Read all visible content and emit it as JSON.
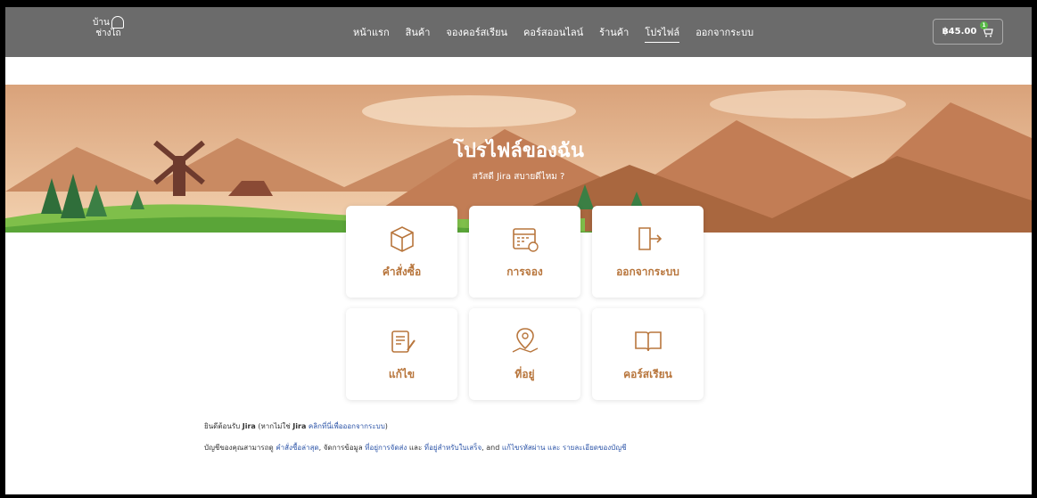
{
  "logo": {
    "line1": "บ้าน",
    "line2": "ช่างไถ"
  },
  "nav": [
    {
      "label": "หน้าแรก",
      "active": false
    },
    {
      "label": "สินค้า",
      "active": false
    },
    {
      "label": "จองคอร์สเรียน",
      "active": false
    },
    {
      "label": "คอร์สออนไลน์",
      "active": false
    },
    {
      "label": "ร้านค้า",
      "active": false
    },
    {
      "label": "โปรไฟล์",
      "active": true
    },
    {
      "label": "ออกจากระบบ",
      "active": false
    }
  ],
  "cart": {
    "amount": "฿45.00",
    "count": "1"
  },
  "hero": {
    "title": "โปรไฟล์ของฉัน",
    "subtitle": "สวัสดี Jira สบายดีไหม ?"
  },
  "cards": [
    {
      "label": "คำสั่งซื้อ",
      "icon": "box-icon"
    },
    {
      "label": "การจอง",
      "icon": "calendar-icon"
    },
    {
      "label": "ออกจากระบบ",
      "icon": "logout-icon"
    },
    {
      "label": "แก้ไข",
      "icon": "edit-icon"
    },
    {
      "label": "ที่อยู่",
      "icon": "map-pin-icon"
    },
    {
      "label": "คอร์สเรียน",
      "icon": "book-icon"
    }
  ],
  "welcome": {
    "prefix": "ยินดีต้อนรับ",
    "user": "Jira",
    "paren_open": "(หากไม่ใช่",
    "user2": "Jira",
    "logout_link": "คลิกที่นี่เพื่อออกจากระบบ",
    "paren_close": ")"
  },
  "account": {
    "prefix": "บัญชีของคุณสามารถดู",
    "link1": "คำสั่งซื้อล่าสุด",
    "text1": ", จัดการข้อมูล",
    "link2": "ที่อยู่การจัดส่ง",
    "text2": "และ",
    "link3": "ที่อยู่สำหรับใบเสร็จ",
    "text3": ", and",
    "link4": "แก้ไขรหัสผ่าน และ รายละเอียดของบัญชี"
  },
  "colors": {
    "topbar": "#6b6b6b",
    "accent": "#b8763d",
    "link": "#2d55a8",
    "badge": "#57b947"
  }
}
